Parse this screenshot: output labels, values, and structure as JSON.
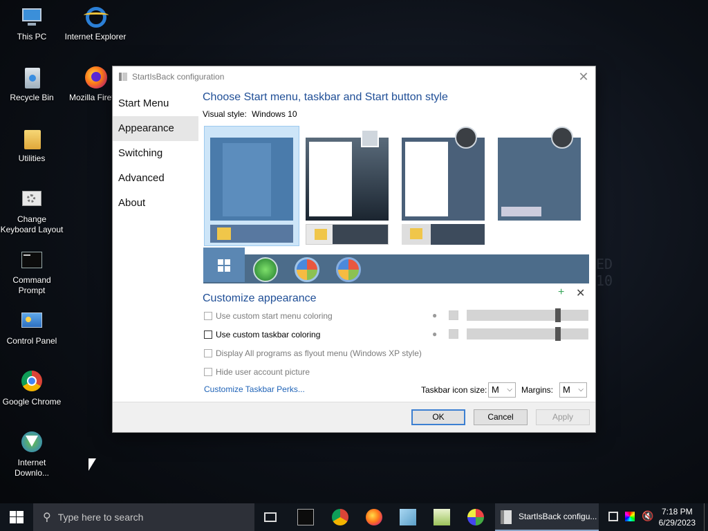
{
  "desktop": {
    "icons": [
      {
        "label": "This PC",
        "icon": "computer-icon"
      },
      {
        "label": "Internet Explorer",
        "icon": "ie-icon"
      },
      {
        "label": "Recycle Bin",
        "icon": "recycle-bin-icon"
      },
      {
        "label": "Mozilla Firef",
        "icon": "firefox-icon"
      },
      {
        "label": "Utilities",
        "icon": "folder-icon"
      },
      {
        "label": "Change Keyboard Layout",
        "icon": "keyboard-icon"
      },
      {
        "label": "Command Prompt",
        "icon": "cmd-icon"
      },
      {
        "label": "Control Panel",
        "icon": "control-panel-icon"
      },
      {
        "label": "Google Chrome",
        "icon": "chrome-icon"
      },
      {
        "label": "Internet Downlo...",
        "icon": "idm-icon"
      }
    ]
  },
  "window": {
    "title": "StartIsBack configuration",
    "nav": [
      "Start Menu",
      "Appearance",
      "Switching",
      "Advanced",
      "About"
    ],
    "active_nav": "Appearance",
    "heading": "Choose Start menu, taskbar and Start button style",
    "visual_style_label": "Visual style:",
    "visual_style_value": "Windows 10",
    "customize_heading": "Customize appearance",
    "options": [
      {
        "label": "Use custom start menu coloring",
        "checked": false,
        "enabled": false
      },
      {
        "label": "Use custom taskbar coloring",
        "checked": false,
        "enabled": true
      },
      {
        "label": "Display All programs as flyout menu (Windows XP style)",
        "checked": false,
        "enabled": false
      },
      {
        "label": "Hide user account picture",
        "checked": false,
        "enabled": false
      }
    ],
    "link": "Customize Taskbar Perks...",
    "taskbar_icon_size_label": "Taskbar icon size:",
    "taskbar_icon_size_value": "M",
    "margins_label": "Margins:",
    "margins_value": "M",
    "buttons": {
      "ok": "OK",
      "cancel": "Cancel",
      "apply": "Apply"
    },
    "colors": {
      "accent": "#1f4e96",
      "selection": "#cde5f8",
      "strip": "#4c6c8a"
    }
  },
  "taskbar": {
    "search_placeholder": "Type here to search",
    "active_app": "StartIsBack configu...",
    "time": "7:18 PM",
    "date": "6/29/2023"
  }
}
